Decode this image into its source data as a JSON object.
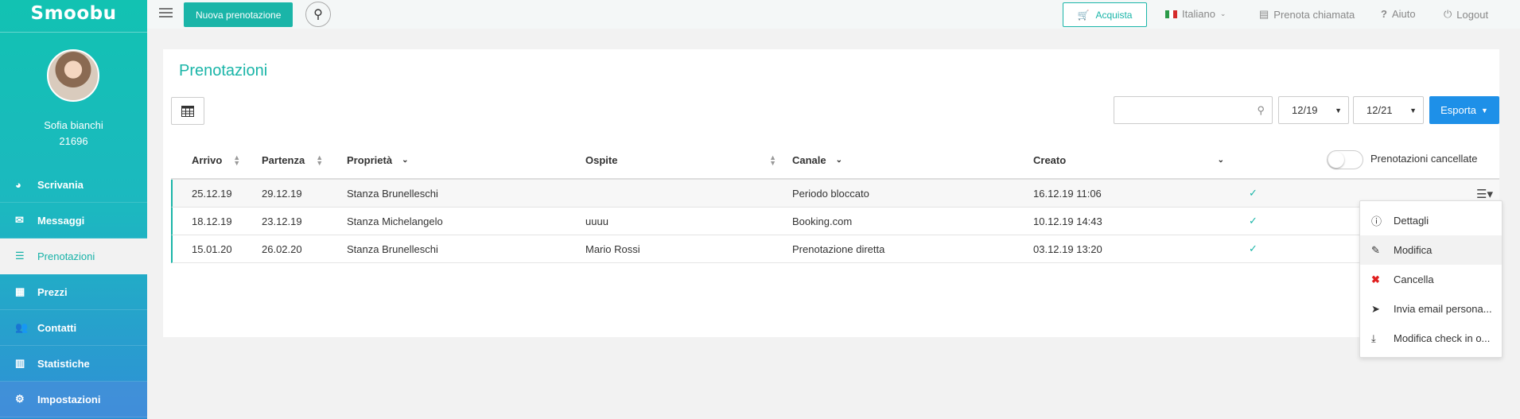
{
  "app": {
    "logo": "Smoobu"
  },
  "user": {
    "name": "Sofia bianchi",
    "id": "21696"
  },
  "sidebar": {
    "items": [
      {
        "label": "Scrivania",
        "icon": "dashboard-icon"
      },
      {
        "label": "Messaggi",
        "icon": "envelope-icon"
      },
      {
        "label": "Prenotazioni",
        "icon": "list-icon"
      },
      {
        "label": "Prezzi",
        "icon": "calculator-icon"
      },
      {
        "label": "Contatti",
        "icon": "users-icon"
      },
      {
        "label": "Statistiche",
        "icon": "bar-chart-icon"
      },
      {
        "label": "Impostazioni",
        "icon": "gear-icon"
      }
    ],
    "active": "Prenotazioni"
  },
  "topbar": {
    "new_booking": "Nuova prenotazione",
    "buy": "Acquista",
    "language": "Italiano",
    "call": "Prenota chiamata",
    "help": "Aiuto",
    "logout": "Logout"
  },
  "page": {
    "title": "Prenotazioni",
    "search_placeholder": "",
    "date_from": "12/19",
    "date_to": "12/21",
    "export": "Esporta",
    "cancelled_toggle": "Prenotazioni cancellate",
    "cancelled_toggle_on": false
  },
  "table": {
    "headers": {
      "arrival": "Arrivo",
      "departure": "Partenza",
      "property": "Proprietà",
      "guest": "Ospite",
      "channel": "Canale",
      "created": "Creato"
    },
    "rows": [
      {
        "arrival": "25.12.19",
        "departure": "29.12.19",
        "property": "Stanza Brunelleschi",
        "guest": "",
        "channel": "Periodo bloccato",
        "created": "16.12.19 11:06",
        "check": "✓"
      },
      {
        "arrival": "18.12.19",
        "departure": "23.12.19",
        "property": "Stanza Michelangelo",
        "guest": "uuuu",
        "channel": "Booking.com",
        "created": "10.12.19 14:43",
        "check": "✓"
      },
      {
        "arrival": "15.01.20",
        "departure": "26.02.20",
        "property": "Stanza Brunelleschi",
        "guest": "Mario Rossi",
        "channel": "Prenotazione diretta",
        "created": "03.12.19 13:20",
        "check": "✓"
      }
    ]
  },
  "row_menu": {
    "items": [
      {
        "label": "Dettagli",
        "icon": "info-icon"
      },
      {
        "label": "Modifica",
        "icon": "pencil-icon"
      },
      {
        "label": "Cancella",
        "icon": "close-icon"
      },
      {
        "label": "Invia email persona...",
        "icon": "send-icon"
      },
      {
        "label": "Modifica check in o...",
        "icon": "download-icon"
      }
    ]
  }
}
